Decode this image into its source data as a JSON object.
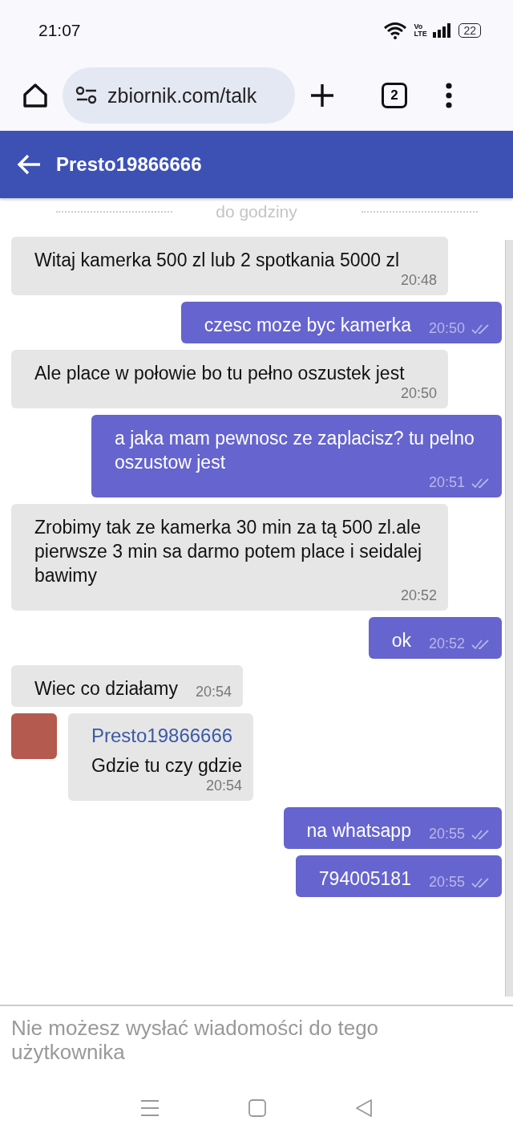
{
  "status_bar": {
    "time": "21:07",
    "network_label": "Vo LTE",
    "battery": "22"
  },
  "browser": {
    "url": "zbiornik.com/talk",
    "tab_count": "2"
  },
  "header": {
    "title": "Presto19866666"
  },
  "divider": "do godziny",
  "messages": [
    {
      "kind": "incoming",
      "text": "Witaj kamerka 500 zl lub 2 spotkania 5000 zl",
      "time": "20:48"
    },
    {
      "kind": "outgoing",
      "text": "czesc moze byc kamerka",
      "time": "20:50",
      "read": true
    },
    {
      "kind": "incoming",
      "text": "Ale place w połowie bo tu pełno oszustek jest",
      "time": "20:50"
    },
    {
      "kind": "outgoing",
      "text": "a jaka mam pewnosc ze zaplacisz? tu pelno oszustow jest",
      "time": "20:51",
      "read": true
    },
    {
      "kind": "incoming",
      "text": "Zrobimy tak ze kamerka 30 min za tą 500 zl.ale pierwsze 3 min sa darmo potem place i seidalej bawimy",
      "time": "20:52"
    },
    {
      "kind": "outgoing",
      "text": "ok",
      "time": "20:52",
      "read": true
    },
    {
      "kind": "incoming",
      "text": "Wiec co działamy",
      "time": "20:54"
    },
    {
      "kind": "incoming_with_sender",
      "sender": "Presto19866666",
      "text": "Gdzie tu czy gdzie",
      "time": "20:54"
    },
    {
      "kind": "outgoing",
      "text": "na whatsapp",
      "time": "20:55",
      "read": true
    },
    {
      "kind": "outgoing",
      "text": "794005181",
      "time": "20:55",
      "read": true
    }
  ],
  "notice": "Nie możesz wysłać wiadomości do tego użytkownika"
}
